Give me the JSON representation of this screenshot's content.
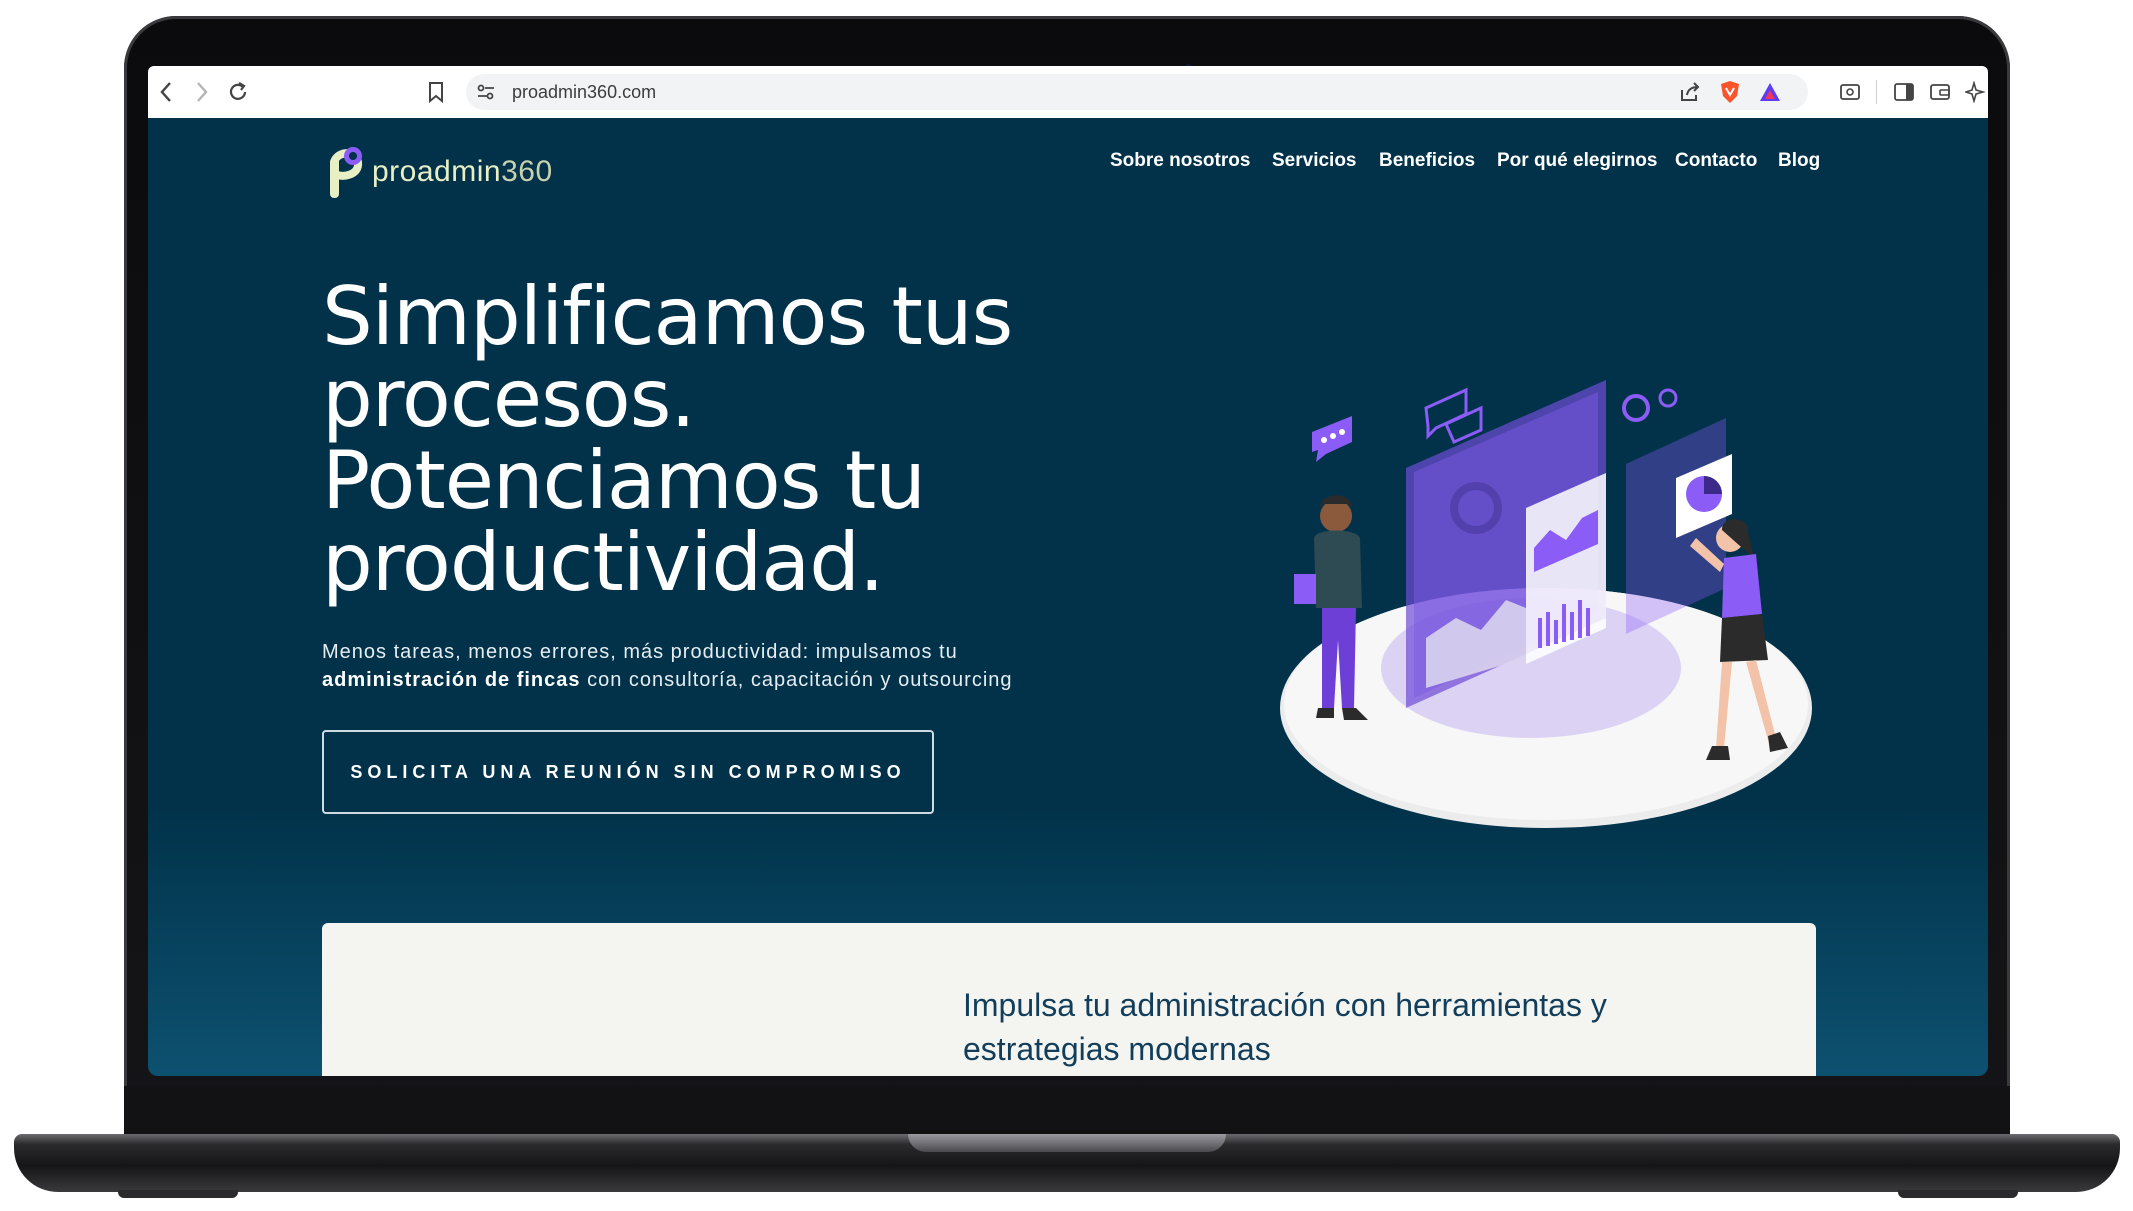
{
  "browser": {
    "url": "proadmin360.com",
    "icons": [
      "back-icon",
      "forward-icon",
      "reload-icon",
      "bookmark-icon",
      "site-settings-icon",
      "share-icon",
      "brave-shield-icon",
      "brave-rewards-icon",
      "screenshot-icon",
      "sidebar-icon",
      "wallet-icon",
      "leo-ai-icon",
      "vpn-icon",
      "menu-icon"
    ]
  },
  "site": {
    "logo": {
      "name": "proadmin",
      "number": "360"
    },
    "nav": [
      "Sobre nosotros",
      "Servicios",
      "Beneficios",
      "Por qué elegirnos",
      "Contacto",
      "Blog"
    ],
    "hero": {
      "title_lines": [
        "Simplificamos tus",
        "procesos.",
        "Potenciamos tu",
        "productividad."
      ],
      "subtitle_line1": "Menos tareas, menos errores, más productividad: impulsamos tu",
      "subtitle_bold": "administración de fincas",
      "subtitle_rest": " con consultoría, capacitación y outsourcing",
      "cta": "SOLICITA UNA REUNIÓN SIN COMPROMISO"
    },
    "section": {
      "title": "Impulsa tu administración con herramientas y estrategias modernas"
    },
    "colors": {
      "background": "#01324a",
      "logo": "#e9efc5",
      "accent": "#8b5cf6",
      "card": "#f4f4f1",
      "card_title": "#123e5b"
    }
  }
}
